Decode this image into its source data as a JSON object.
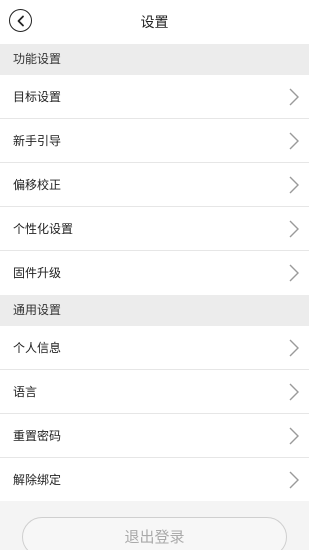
{
  "header": {
    "title": "设置",
    "back_icon": "chevron-left-icon"
  },
  "sections": [
    {
      "title": "功能设置",
      "items": [
        {
          "label": "目标设置"
        },
        {
          "label": "新手引导"
        },
        {
          "label": "偏移校正"
        },
        {
          "label": "个性化设置"
        },
        {
          "label": "固件升级"
        }
      ]
    },
    {
      "title": "通用设置",
      "items": [
        {
          "label": "个人信息"
        },
        {
          "label": "语言"
        },
        {
          "label": "重置密码"
        },
        {
          "label": "解除绑定"
        }
      ]
    }
  ],
  "footer": {
    "logout_label": "退出登录"
  },
  "colors": {
    "section_bg": "#ececec",
    "chevron": "#9a9a9a",
    "divider": "#e6e6e6"
  }
}
